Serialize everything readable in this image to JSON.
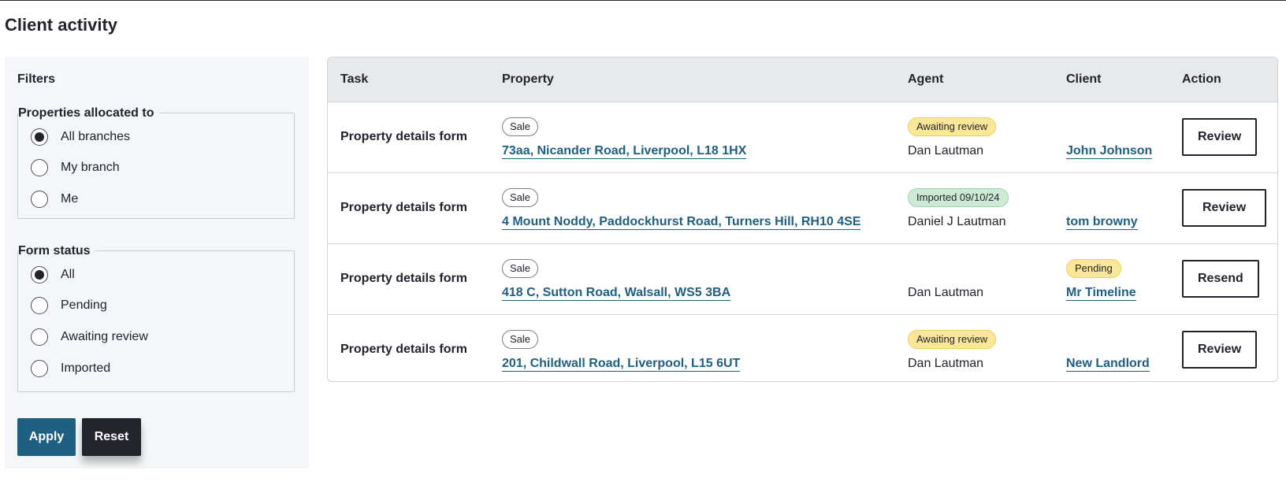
{
  "page": {
    "title": "Client activity"
  },
  "filters": {
    "title": "Filters",
    "allocated": {
      "legend": "Properties allocated to",
      "options": [
        "All branches",
        "My branch",
        "Me"
      ],
      "selected": "All branches"
    },
    "form_status": {
      "legend": "Form status",
      "options": [
        "All",
        "Pending",
        "Awaiting review",
        "Imported"
      ],
      "selected": "All"
    },
    "apply_label": "Apply",
    "reset_label": "Reset"
  },
  "table": {
    "headers": {
      "task": "Task",
      "property": "Property",
      "agent": "Agent",
      "client": "Client",
      "action": "Action"
    },
    "rows": [
      {
        "task": "Property details form",
        "tag": "Sale",
        "property": "73aa, Nicander Road, Liverpool, L18 1HX",
        "agent_status": "Awaiting review",
        "agent": "Dan Lautman",
        "client_status": "",
        "client": "John Johnson",
        "action": "Review"
      },
      {
        "task": "Property details form",
        "tag": "Sale",
        "property": "4 Mount Noddy, Paddockhurst Road, Turners Hill, RH10 4SE",
        "agent_status": "Imported 09/10/24",
        "agent": "Daniel J Lautman",
        "client_status": "",
        "client": "tom browny",
        "action": "Review"
      },
      {
        "task": "Property details form",
        "tag": "Sale",
        "property": "418 C, Sutton Road, Walsall, WS5 3BA",
        "agent_status": "",
        "agent": "Dan Lautman",
        "client_status": "Pending",
        "client": "Mr Timeline",
        "action": "Resend"
      },
      {
        "task": "Property details form",
        "tag": "Sale",
        "property": "201, Childwall Road, Liverpool, L15 6UT",
        "agent_status": "Awaiting review",
        "agent": "Dan Lautman",
        "client_status": "",
        "client": "New Landlord",
        "action": "Review"
      }
    ]
  },
  "colors": {
    "link": "#1f5f82",
    "apply_bg": "#1f5f82",
    "reset_bg": "#24242c",
    "awaiting_bg": "#fbe79a",
    "imported_bg": "#cdebd4",
    "pending_bg": "#fbe79a",
    "panel_bg": "#f4f6f9",
    "header_bg": "#e8e9eb"
  }
}
